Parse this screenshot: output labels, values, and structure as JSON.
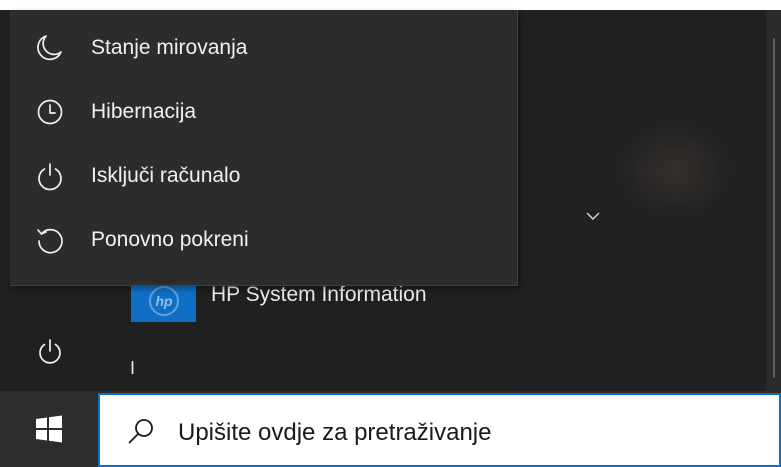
{
  "power_menu": {
    "items": [
      {
        "label": "Stanje mirovanja",
        "icon": "moon-icon"
      },
      {
        "label": "Hibernacija",
        "icon": "clock-icon"
      },
      {
        "label": "Isključi računalo",
        "icon": "power-icon"
      },
      {
        "label": "Ponovno pokreni",
        "icon": "restart-icon"
      }
    ]
  },
  "app_list": {
    "items": [
      {
        "label": "HP System Information",
        "icon": "hp-logo-icon"
      }
    ],
    "group_letter": "I"
  },
  "sidebar": {
    "power_button": "power-icon"
  },
  "taskbar": {
    "start_icon": "windows-logo-icon",
    "search": {
      "placeholder": "Upišite ovdje za pretraživanje",
      "icon": "search-icon"
    }
  },
  "colors": {
    "start_background": "#1f2020",
    "flyout_background": "#2c2c2c",
    "taskbar_background": "#2d2d2d",
    "search_border": "#0a70c8",
    "tile_accent": "#0f6fc7",
    "text_light": "#f1f1f1"
  }
}
